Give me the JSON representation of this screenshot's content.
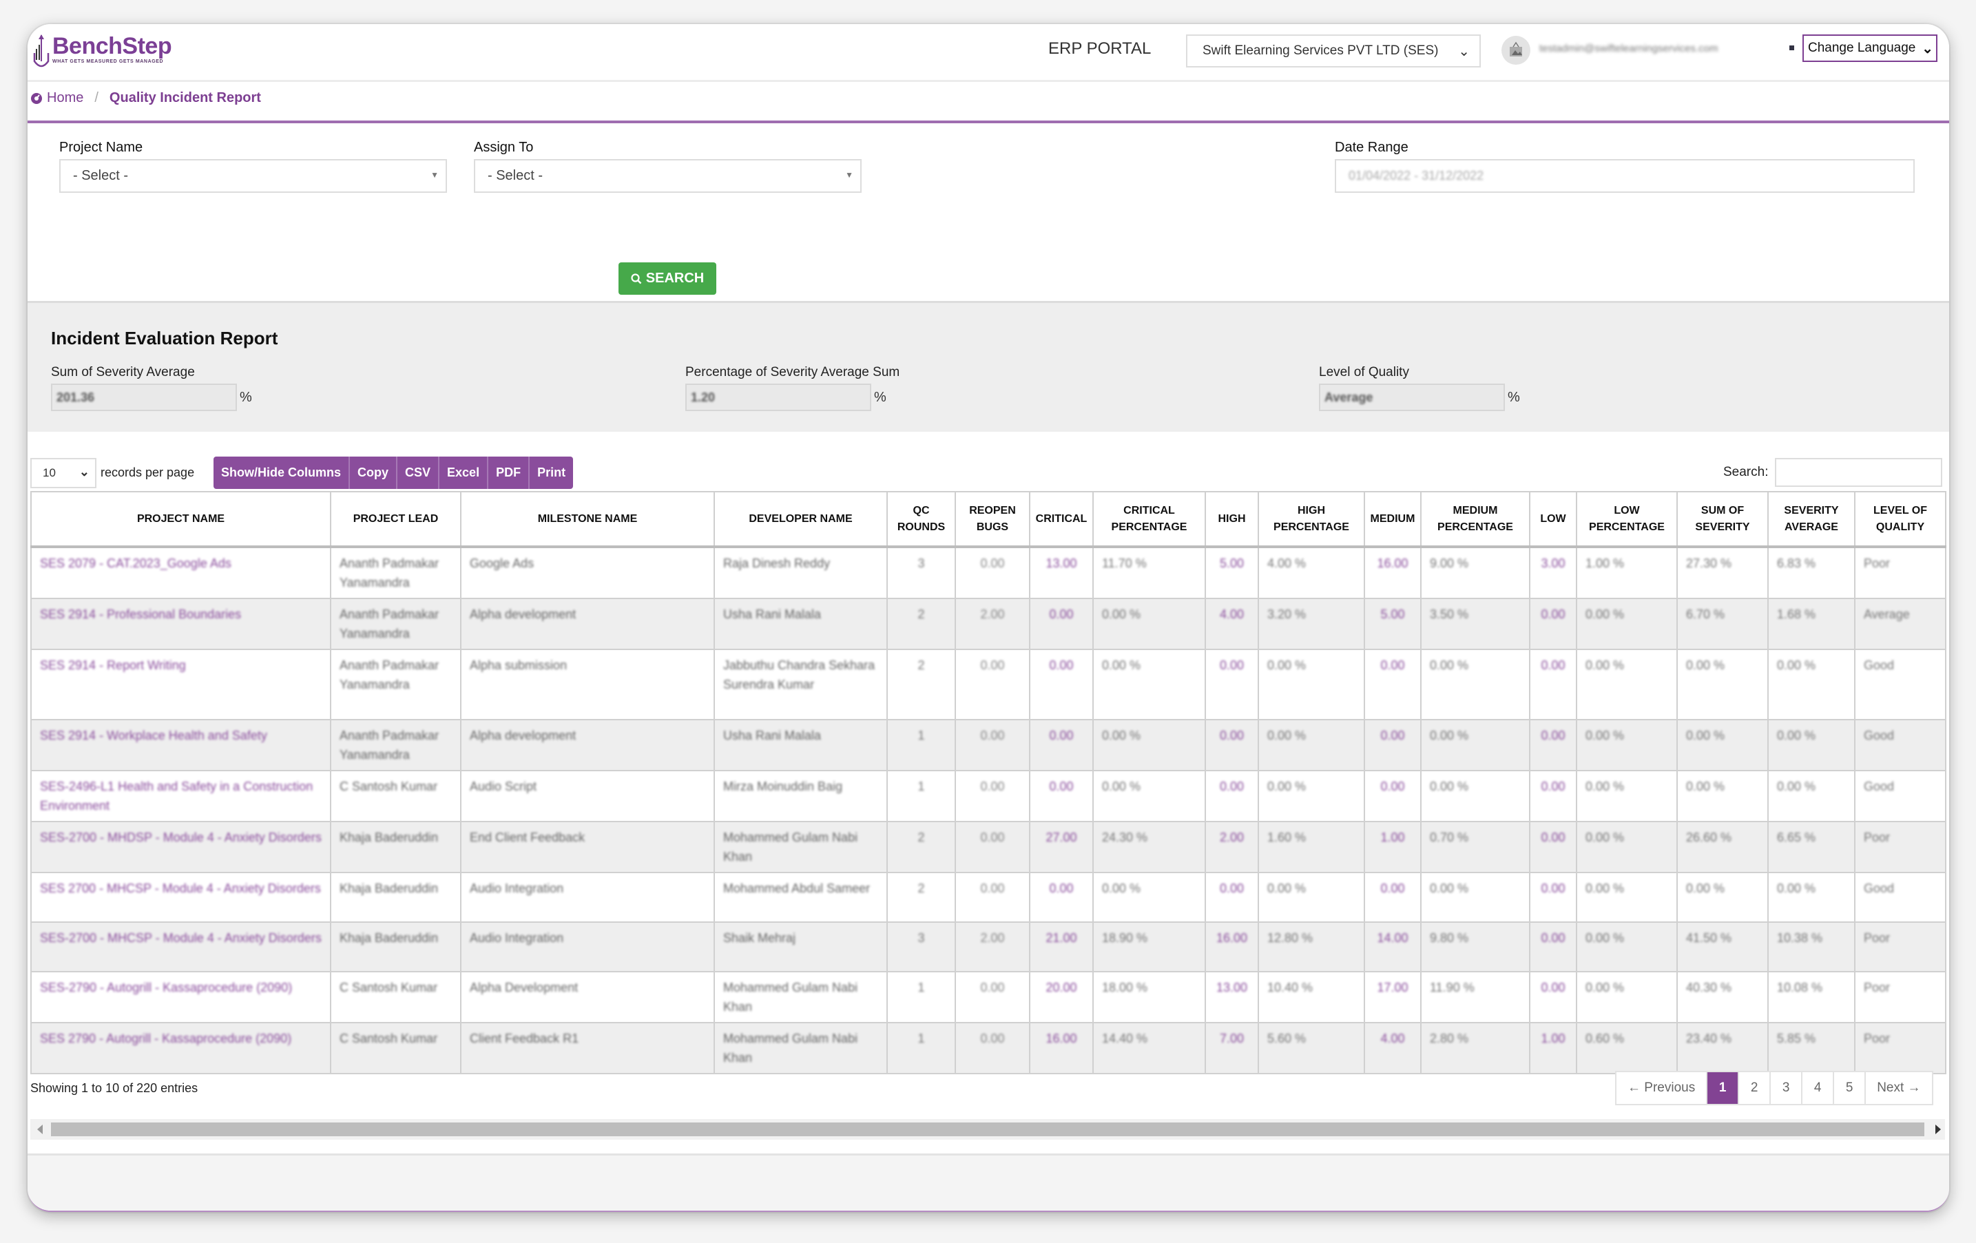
{
  "header": {
    "brand_name": "BenchStep",
    "brand_tagline": "WHAT GETS MEASURED GETS MANAGED",
    "portal_title": "ERP PORTAL",
    "company_select_value": "Swift Elearning Services PVT LTD (SES)",
    "user_email": "testadmin@swiftelearningservices.com",
    "language_select_value": "Change Language",
    "brand_color": "#7b3f95"
  },
  "breadcrumb": {
    "home": "Home",
    "separator": "/",
    "current": "Quality Incident Report"
  },
  "filters": {
    "project_name_label": "Project Name",
    "project_name_value": "- Select -",
    "assign_to_label": "Assign To",
    "assign_to_value": "- Select -",
    "date_range_label": "Date Range",
    "date_range_value": "01/04/2022 - 31/12/2022",
    "search_button": "SEARCH"
  },
  "evaluation": {
    "title": "Incident Evaluation Report",
    "sum_label": "Sum of Severity Average",
    "sum_value": "201.36",
    "pct_label": "Percentage of Severity Average Sum",
    "pct_value": "1.20",
    "level_label": "Level of Quality",
    "level_value": "Average",
    "unit": "%"
  },
  "toolbar": {
    "page_length": "10",
    "page_length_label": "records per page",
    "buttons": [
      "Show/Hide Columns",
      "Copy",
      "CSV",
      "Excel",
      "PDF",
      "Print"
    ],
    "search_label": "Search:",
    "search_value": ""
  },
  "table": {
    "columns": [
      "PROJECT NAME",
      "PROJECT LEAD",
      "MILESTONE NAME",
      "DEVELOPER NAME",
      "QC ROUNDS",
      "REOPEN BUGS",
      "CRITICAL",
      "CRITICAL PERCENTAGE",
      "HIGH",
      "HIGH PERCENTAGE",
      "MEDIUM",
      "MEDIUM PERCENTAGE",
      "LOW",
      "LOW PERCENTAGE",
      "SUM OF SEVERITY",
      "SEVERITY AVERAGE",
      "LEVEL OF QUALITY"
    ],
    "rows": [
      [
        "SES 2079 - CAT.2023_Google Ads",
        "Ananth Padmakar Yanamandra",
        "Google Ads",
        "Raja Dinesh Reddy",
        "3",
        "0.00",
        "13.00",
        "11.70 %",
        "5.00",
        "4.00 %",
        "16.00",
        "9.00 %",
        "3.00",
        "1.00 %",
        "27.30 %",
        "6.83 %",
        "Poor"
      ],
      [
        "SES 2914 - Professional Boundaries",
        "Ananth Padmakar Yanamandra",
        "Alpha development",
        "Usha Rani Malala",
        "2",
        "2.00",
        "0.00",
        "0.00 %",
        "4.00",
        "3.20 %",
        "5.00",
        "3.50 %",
        "0.00",
        "0.00 %",
        "6.70 %",
        "1.68 %",
        "Average"
      ],
      [
        "SES 2914 - Report Writing",
        "Ananth Padmakar Yanamandra",
        "Alpha submission",
        "Jabbuthu Chandra Sekhara Surendra Kumar",
        "2",
        "0.00",
        "0.00",
        "0.00 %",
        "0.00",
        "0.00 %",
        "0.00",
        "0.00 %",
        "0.00",
        "0.00 %",
        "0.00 %",
        "0.00 %",
        "Good"
      ],
      [
        "SES 2914 - Workplace Health and Safety",
        "Ananth Padmakar Yanamandra",
        "Alpha development",
        "Usha Rani Malala",
        "1",
        "0.00",
        "0.00",
        "0.00 %",
        "0.00",
        "0.00 %",
        "0.00",
        "0.00 %",
        "0.00",
        "0.00 %",
        "0.00 %",
        "0.00 %",
        "Good"
      ],
      [
        "SES-2496-L1 Health and Safety in a Construction Environment",
        "C Santosh Kumar",
        "Audio Script",
        "Mirza Moinuddin Baig",
        "1",
        "0.00",
        "0.00",
        "0.00 %",
        "0.00",
        "0.00 %",
        "0.00",
        "0.00 %",
        "0.00",
        "0.00 %",
        "0.00 %",
        "0.00 %",
        "Good"
      ],
      [
        "SES-2700 - MHDSP - Module 4 - Anxiety Disorders",
        "Khaja Baderuddin",
        "End Client Feedback",
        "Mohammed Gulam Nabi Khan",
        "2",
        "0.00",
        "27.00",
        "24.30 %",
        "2.00",
        "1.60 %",
        "1.00",
        "0.70 %",
        "0.00",
        "0.00 %",
        "26.60 %",
        "6.65 %",
        "Poor"
      ],
      [
        "SES 2700 - MHCSP - Module 4 - Anxiety Disorders",
        "Khaja Baderuddin",
        "Audio Integration",
        "Mohammed Abdul Sameer",
        "2",
        "0.00",
        "0.00",
        "0.00 %",
        "0.00",
        "0.00 %",
        "0.00",
        "0.00 %",
        "0.00",
        "0.00 %",
        "0.00 %",
        "0.00 %",
        "Good"
      ],
      [
        "SES-2700 - MHCSP - Module 4 - Anxiety Disorders",
        "Khaja Baderuddin",
        "Audio Integration",
        "Shaik Mehraj",
        "3",
        "2.00",
        "21.00",
        "18.90 %",
        "16.00",
        "12.80 %",
        "14.00",
        "9.80 %",
        "0.00",
        "0.00 %",
        "41.50 %",
        "10.38 %",
        "Poor"
      ],
      [
        "SES-2790 - Autogrill - Kassaprocedure (2090)",
        "C Santosh Kumar",
        "Alpha Development",
        "Mohammed Gulam Nabi Khan",
        "1",
        "0.00",
        "20.00",
        "18.00 %",
        "13.00",
        "10.40 %",
        "17.00",
        "11.90 %",
        "0.00",
        "0.00 %",
        "40.30 %",
        "10.08 %",
        "Poor"
      ],
      [
        "SES 2790 - Autogrill - Kassaprocedure (2090)",
        "C Santosh Kumar",
        "Client Feedback R1",
        "Mohammed Gulam Nabi Khan",
        "1",
        "0.00",
        "16.00",
        "14.40 %",
        "7.00",
        "5.60 %",
        "4.00",
        "2.80 %",
        "1.00",
        "0.60 %",
        "23.40 %",
        "5.85 %",
        "Poor"
      ]
    ]
  },
  "footer": {
    "showing_text": "Showing 1 to 10 of 220 entries",
    "prev_label": "← Previous",
    "next_label": "Next →",
    "pages": [
      "1",
      "2",
      "3",
      "4",
      "5"
    ],
    "current_page": "1"
  }
}
